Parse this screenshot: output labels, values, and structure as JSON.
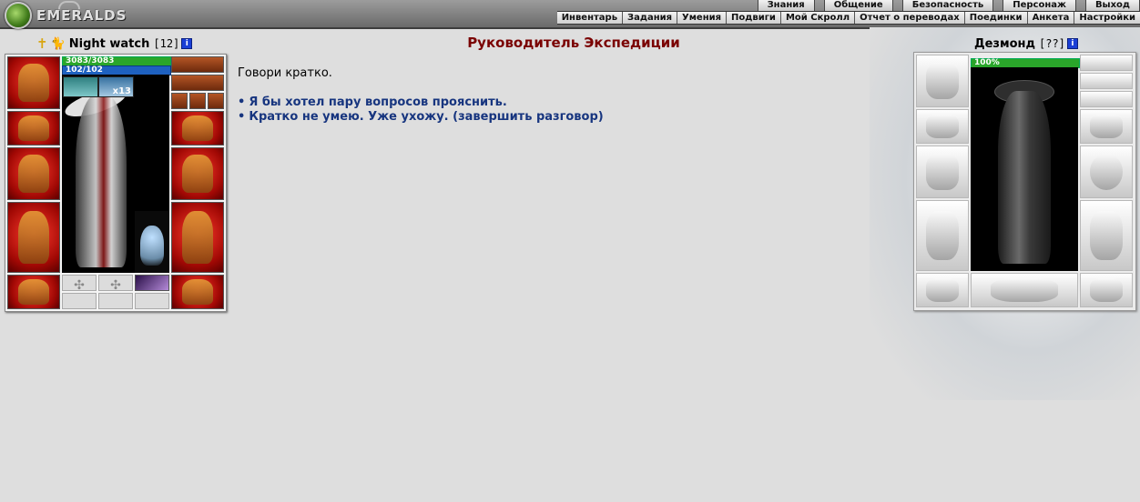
{
  "header": {
    "logo_text": "EMERALDS",
    "menu_top": [
      "Знания",
      "Общение",
      "Безопасность",
      "Персонаж",
      "Выход"
    ],
    "menu_bottom": [
      "Инвентарь",
      "Задания",
      "Умения",
      "Подвиги",
      "Мой Скролл",
      "Отчет о переводах",
      "Поединки",
      "Анкета",
      "Настройки"
    ]
  },
  "player": {
    "name": "Night watch",
    "level": "[12]",
    "hp": "3083/3083",
    "mp": "102/102",
    "buff_count": "x13",
    "icons": [
      "cross-icon",
      "cat-icon",
      "info-icon"
    ]
  },
  "dialogue": {
    "title": "Руководитель Экспедиции",
    "text": "Говори кратко.",
    "options": [
      "Я бы хотел пару вопросов прояснить.",
      "Кратко не умею. Уже ухожу. (завершить разговор)"
    ]
  },
  "npc": {
    "name": "Дезмонд",
    "level": "[??]",
    "hp_percent": "100%"
  },
  "colors": {
    "title": "#7a0000",
    "link": "#17357f",
    "hp": "#2aa62a",
    "mp": "#1e61c0",
    "slot_red": "#c0140c",
    "background": "#dedede"
  }
}
